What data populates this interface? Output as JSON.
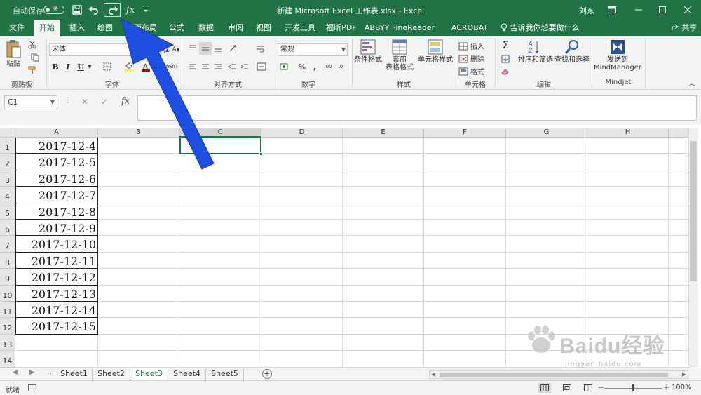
{
  "titlebar": {
    "autosave_label": "自动保存",
    "autosave_state": "关",
    "title": "新建 Microsoft Excel 工作表.xlsx  -  Excel",
    "user": "刘东"
  },
  "tabs": [
    {
      "label": "文件",
      "active": false
    },
    {
      "label": "开始",
      "active": true
    },
    {
      "label": "插入",
      "active": false
    },
    {
      "label": "绘图",
      "active": false
    },
    {
      "label": "页面布局",
      "active": false
    },
    {
      "label": "公式",
      "active": false
    },
    {
      "label": "数据",
      "active": false
    },
    {
      "label": "审阅",
      "active": false
    },
    {
      "label": "视图",
      "active": false
    },
    {
      "label": "开发工具",
      "active": false
    },
    {
      "label": "福昕PDF",
      "active": false
    },
    {
      "label": "ABBYY FineReader 12",
      "active": false
    },
    {
      "label": "ACROBAT",
      "active": false
    }
  ],
  "tellme": "告诉我你想要做什么",
  "share": "共享",
  "ribbon": {
    "clipboard": {
      "label": "剪贴板",
      "paste": "粘贴"
    },
    "font": {
      "label": "字体",
      "name": "宋体",
      "size": "11",
      "bold": "B",
      "italic": "I",
      "underline": "U"
    },
    "alignment": {
      "label": "对齐方式"
    },
    "number": {
      "label": "数字",
      "format": "常规"
    },
    "styles": {
      "label": "样式",
      "conditional": "条件格式",
      "table_1": "套用",
      "table_2": "表格格式",
      "cell_styles": "单元格样式"
    },
    "cells": {
      "label": "单元格",
      "insert": "插入",
      "delete": "删除",
      "format": "格式"
    },
    "editing": {
      "label": "编辑",
      "sort": "排序和筛选",
      "find": "查找和选择"
    },
    "mindjet": {
      "label": "Mindjet",
      "send_1": "发送到",
      "send_2": "MindManager"
    }
  },
  "formula_bar": {
    "name_box": "C1",
    "fx": "fx",
    "value": ""
  },
  "grid": {
    "columns": [
      "A",
      "B",
      "C",
      "D",
      "E",
      "F",
      "G",
      "H"
    ],
    "selected_column": "C",
    "rows": [
      "1",
      "2",
      "3",
      "4",
      "5",
      "6",
      "7",
      "8",
      "9",
      "10",
      "11",
      "12",
      "13",
      "14"
    ],
    "column_a_values": [
      "2017-12-4",
      "2017-12-5",
      "2017-12-6",
      "2017-12-7",
      "2017-12-8",
      "2017-12-9",
      "2017-12-10",
      "2017-12-11",
      "2017-12-12",
      "2017-12-13",
      "2017-12-14",
      "2017-12-15"
    ]
  },
  "sheets": [
    {
      "name": "Sheet1",
      "active": false
    },
    {
      "name": "Sheet2",
      "active": false
    },
    {
      "name": "Sheet3",
      "active": true
    },
    {
      "name": "Sheet4",
      "active": false
    },
    {
      "name": "Sheet5",
      "active": false
    }
  ],
  "status": {
    "ready": "就绪",
    "zoom": "100%",
    "zoom_level": 1.0
  },
  "watermark": {
    "text": "Baidu经验",
    "url": "jingyan.baidu.com"
  },
  "colors": {
    "accent": "#217346",
    "arrow": "#1f4fe0"
  },
  "icons": [
    "save-icon",
    "undo-icon",
    "redo-icon",
    "fx-icon",
    "customize-qat-icon",
    "ribbon-display-icon",
    "minimize-icon",
    "maximize-icon",
    "close-icon",
    "lightbulb-icon",
    "share-icon",
    "paste-icon",
    "cut-icon",
    "copy-icon",
    "format-painter-icon",
    "sum-icon",
    "sort-filter-icon",
    "find-icon",
    "mindmanager-icon",
    "arrow-annotation-icon"
  ]
}
